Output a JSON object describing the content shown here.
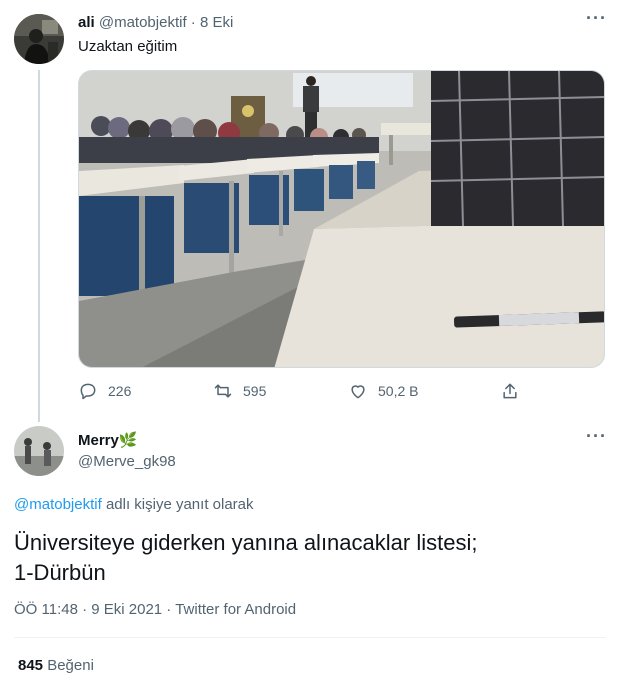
{
  "tweet": {
    "author_name": "ali",
    "author_handle": "@matobjektif",
    "separator": "·",
    "date": "8 Eki",
    "text": "Uzaktan eğitim",
    "actions": {
      "replies": "226",
      "retweets": "595",
      "likes": "50,2 B"
    }
  },
  "reply": {
    "author_name": "Merry",
    "author_emoji": "🌿",
    "author_handle": "@Merve_gk98",
    "reply_to_handle": "@matobjektif",
    "reply_to_suffix": "adlı kişiye yanıt olarak",
    "text_line1": "Üniversiteye giderken yanına alınacaklar listesi;",
    "text_line2": "1-Dürbün",
    "meta": "ÖÖ 11:48 · 9 Eki 2021 · Twitter for Android",
    "likes_count": "845",
    "likes_label": "Beğeni"
  },
  "icons": {
    "more": "more-icon",
    "reply": "reply-icon",
    "retweet": "retweet-icon",
    "like": "heart-icon",
    "share": "share-icon"
  },
  "colors": {
    "link": "#1d9bf0",
    "muted": "#536471",
    "divider": "#eff3f4"
  }
}
